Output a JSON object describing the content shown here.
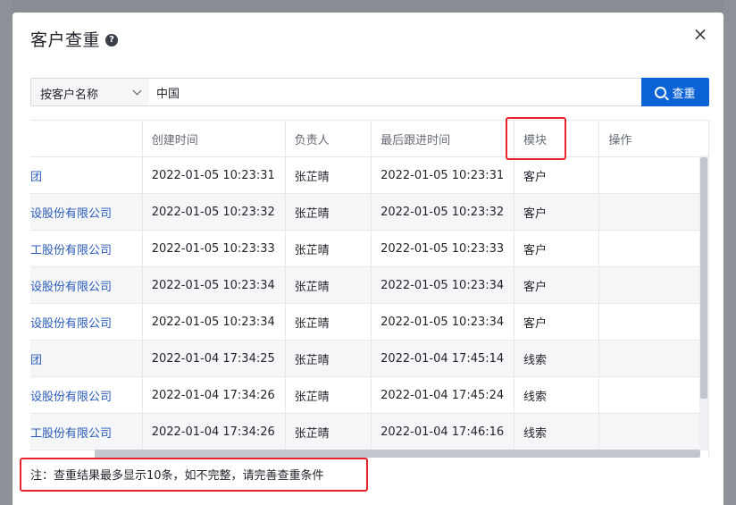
{
  "modal": {
    "title": "客户查重",
    "close_glyph": "×"
  },
  "search": {
    "select_value": "按客户名称",
    "input_value": "中国",
    "button_label": "查重"
  },
  "table": {
    "columns": [
      "",
      "创建时间",
      "负责人",
      "最后跟进时间",
      "模块",
      "操作"
    ],
    "rows": [
      [
        "团",
        "2022-01-05 10:23:31",
        "张芷晴",
        "2022-01-05 10:23:31",
        "客户",
        ""
      ],
      [
        "设股份有限公司",
        "2022-01-05 10:23:32",
        "张芷晴",
        "2022-01-05 10:23:32",
        "客户",
        ""
      ],
      [
        "工股份有限公司",
        "2022-01-05 10:23:33",
        "张芷晴",
        "2022-01-05 10:23:33",
        "客户",
        ""
      ],
      [
        "设股份有限公司",
        "2022-01-05 10:23:34",
        "张芷晴",
        "2022-01-05 10:23:34",
        "客户",
        ""
      ],
      [
        "设股份有限公司",
        "2022-01-05 10:23:34",
        "张芷晴",
        "2022-01-05 10:23:34",
        "客户",
        ""
      ],
      [
        "团",
        "2022-01-04 17:34:25",
        "张芷晴",
        "2022-01-04 17:45:14",
        "线索",
        ""
      ],
      [
        "设股份有限公司",
        "2022-01-04 17:34:26",
        "张芷晴",
        "2022-01-04 17:45:24",
        "线索",
        ""
      ],
      [
        "工股份有限公司",
        "2022-01-04 17:34:26",
        "张芷晴",
        "2022-01-04 17:46:16",
        "线索",
        ""
      ],
      [
        "",
        "",
        "",
        "",
        "",
        ""
      ]
    ]
  },
  "note": "注：查重结果最多显示10条，如不完整，请完善查重条件",
  "colors": {
    "accent": "#0b63d6",
    "highlight": "#e5242b",
    "link": "#2a5ab8"
  }
}
